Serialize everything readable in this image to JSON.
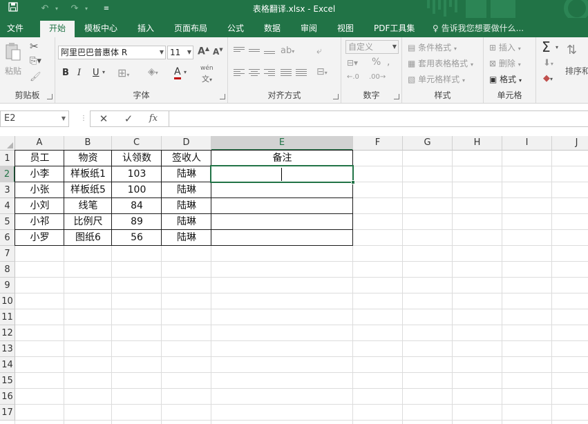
{
  "titlebar": {
    "title": "表格翻译.xlsx - Excel",
    "accent": "#217346"
  },
  "tabs": [
    "文件",
    "开始",
    "模板中心",
    "插入",
    "页面布局",
    "公式",
    "数据",
    "审阅",
    "视图",
    "PDF工具集"
  ],
  "active_tab": "开始",
  "tell_me": "告诉我您想要做什么...",
  "ribbon": {
    "clipboard": {
      "label": "剪贴板",
      "paste": "粘贴"
    },
    "font": {
      "label": "字体",
      "font_name": "阿里巴巴普惠体 R",
      "font_size": "11",
      "bold": "B",
      "italic": "I",
      "underline": "U",
      "grow": "A",
      "shrink": "A",
      "font_color": "A",
      "pinyin": "wén"
    },
    "alignment": {
      "label": "对齐方式"
    },
    "number": {
      "label": "数字",
      "format": "自定义",
      "percent": "%"
    },
    "styles": {
      "label": "样式",
      "conditional": "条件格式",
      "table": "套用表格格式",
      "cell_styles": "单元格样式"
    },
    "cells": {
      "label": "单元格",
      "insert": "插入",
      "delete": "删除",
      "format": "格式"
    },
    "editing": {
      "sum": "Σ",
      "sort": "排序和"
    }
  },
  "formula_bar": {
    "name_box": "E2",
    "fx": "fx",
    "value": ""
  },
  "sheet": {
    "columns": [
      "A",
      "B",
      "C",
      "D",
      "E",
      "F",
      "G",
      "H",
      "I",
      "J"
    ],
    "rows": [
      "1",
      "2",
      "3",
      "4",
      "5",
      "6",
      "7",
      "8",
      "9",
      "10",
      "11",
      "12",
      "13",
      "14",
      "15",
      "16",
      "17"
    ],
    "active_cell": "E2",
    "table": [
      [
        "员工",
        "物资",
        "认领数",
        "签收人",
        "备注"
      ],
      [
        "小李",
        "样板纸1",
        "103",
        "陆琳",
        ""
      ],
      [
        "小张",
        "样板纸5",
        "100",
        "陆琳",
        ""
      ],
      [
        "小刘",
        "线笔",
        "84",
        "陆琳",
        ""
      ],
      [
        "小祁",
        "比例尺",
        "89",
        "陆琳",
        ""
      ],
      [
        "小罗",
        "图纸6",
        "56",
        "陆琳",
        ""
      ]
    ]
  }
}
